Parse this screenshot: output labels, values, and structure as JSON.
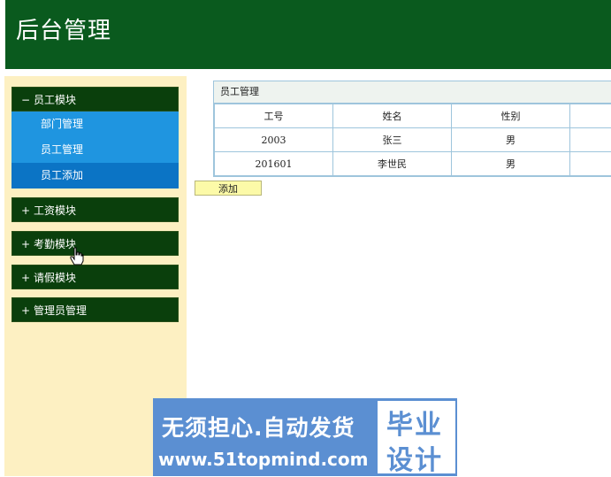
{
  "header": {
    "title": "后台管理"
  },
  "sidebar": {
    "groups": [
      {
        "sign": "−",
        "label": "员工模块"
      },
      {
        "sign": "+",
        "label": "工资模块"
      },
      {
        "sign": "+",
        "label": "考勤模块"
      },
      {
        "sign": "+",
        "label": "请假模块"
      },
      {
        "sign": "+",
        "label": "管理员管理"
      }
    ],
    "sub_items": [
      {
        "label": "部门管理"
      },
      {
        "label": "员工管理"
      },
      {
        "label": "员工添加"
      }
    ]
  },
  "panel": {
    "title": "员工管理",
    "columns": [
      "工号",
      "姓名",
      "性别"
    ],
    "rows": [
      [
        "2003",
        "张三",
        "男"
      ],
      [
        "201601",
        "李世民",
        "男"
      ]
    ]
  },
  "add_button": {
    "label": "添加"
  },
  "watermark": {
    "line1": "无须担心.自动发货",
    "line2": "www.51topmind.com",
    "box_top": "毕业",
    "box_bottom": "设计"
  },
  "colors": {
    "header": "#0a5a1e",
    "sidebar_bg": "#fdf0c2",
    "menu_head": "#0a3f0c",
    "menu_sub": "#1f95e0",
    "menu_sub_hover": "#0b74c5",
    "watermark": "#5b8fd2"
  }
}
